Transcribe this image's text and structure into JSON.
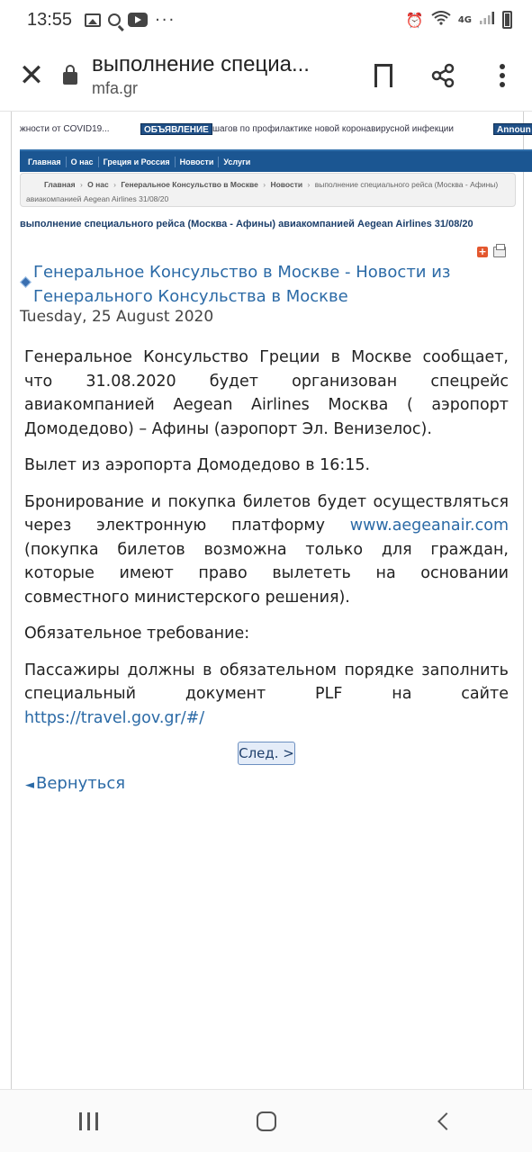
{
  "status_bar": {
    "time": "13:55",
    "more": "···",
    "network": "4G"
  },
  "browser": {
    "title": "выполнение специа...",
    "url": "mfa.gr"
  },
  "ticker": {
    "left_text": "жности от COVID19...",
    "badge": "ОБЪЯВЛЕНИЕ",
    "text": "шагов по профилактике новой коронавирусной инфекции",
    "right_badge": "Announ"
  },
  "nav": [
    "Главная",
    "О нас",
    "Греция и Россия",
    "Новости",
    "Услуги"
  ],
  "breadcrumb": {
    "items": [
      "Главная",
      "О нас",
      "Генеральное Консульство в Москве",
      "Новости"
    ],
    "current_part1": "выполнение специального рейса (Москва - Афины)",
    "current_part2": "авиакомпанией Aegean Airlines 31/08/20"
  },
  "heading": "выполнение специального рейса (Москва - Афины) авиакомпанией Aegean Airlines 31/08/20",
  "source": {
    "line1": "Генеральное Консульство в Москве - Новости из",
    "line2": "Генерального Консульства в Москве"
  },
  "date": "Tuesday, 25 August 2020",
  "article": {
    "p1": "Генеральное Консульство Греции в Москве сообщает, что 31.08.2020 будет организован спецрейс авиакомпанией Aegean Airlines   Москва ( аэропорт Домодедово) – Афины (аэропорт Эл. Венизелос).",
    "p2": "Вылет из аэропорта Домодедово в 16:15.",
    "p3_before": "Бронирование и покупка билетов будет осуществляться через электронную платформу ",
    "p3_link": "www.aegeanair.com",
    "p3_after": " (покупка билетов возможна только для граждан, которые имеют право вылететь на основании совместного министерского решения).",
    "p4": "Обязательное требование:",
    "p5_before": "Пассажиры должны в обязательном порядке заполнить специальный документ PLF на сайте ",
    "p5_link": "https://travel.gov.gr/#/"
  },
  "next_button": "След. >",
  "back_link": "Вернуться",
  "back_arrow": "◄"
}
